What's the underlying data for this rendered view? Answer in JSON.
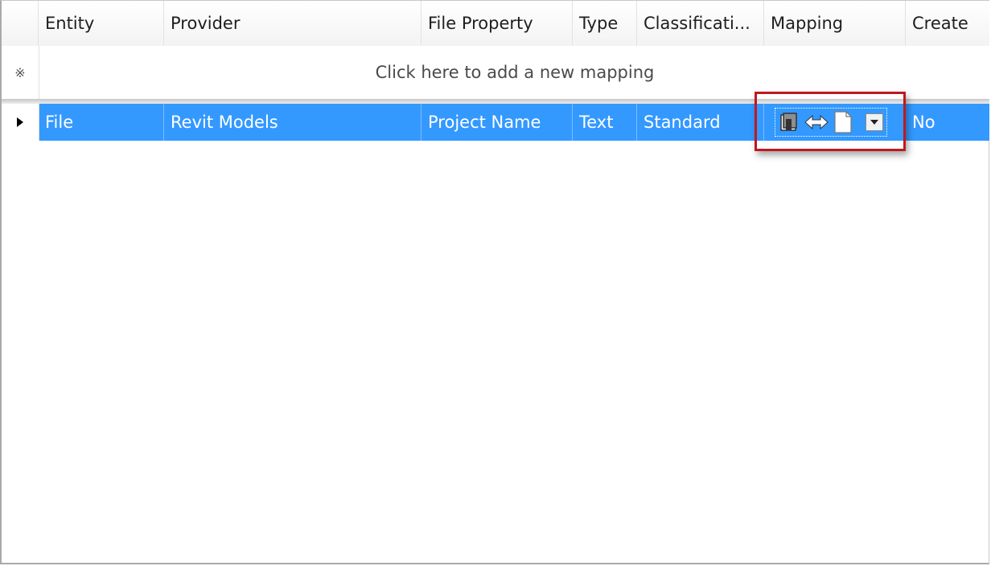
{
  "columns": [
    {
      "label": "Entity"
    },
    {
      "label": "Provider"
    },
    {
      "label": "File Property"
    },
    {
      "label": "Type"
    },
    {
      "label": "Classificati..."
    },
    {
      "label": "Mapping"
    },
    {
      "label": "Create"
    }
  ],
  "new_row": {
    "marker": "※",
    "hint": "Click here to add a new mapping"
  },
  "rows": [
    {
      "entity": "File",
      "provider": "Revit Models",
      "file_property": "Project Name",
      "type": "Text",
      "classification": "Standard",
      "mapping_icons": [
        "content-source-icon",
        "bidirectional-arrow-icon",
        "document-icon",
        "dropdown-arrow-icon"
      ],
      "create": "No"
    }
  ],
  "colors": {
    "selection": "#3399ff",
    "highlight_border": "#c0181f"
  }
}
